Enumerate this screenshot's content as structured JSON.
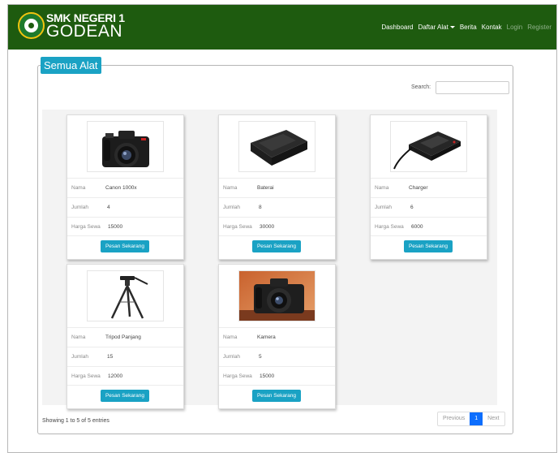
{
  "nav": {
    "brand_line1": "SMK NEGERI 1",
    "brand_line2": "GODEAN",
    "items": [
      {
        "label": "Dashboard"
      },
      {
        "label": "Daftar Alat"
      },
      {
        "label": "Berita"
      },
      {
        "label": "Kontak"
      },
      {
        "label": "Login"
      },
      {
        "label": "Register"
      }
    ]
  },
  "panel": {
    "title": "Semua Alat",
    "search_label": "Search:",
    "search_value": ""
  },
  "labels": {
    "nama": "Nama",
    "jumlah": "Jumlah",
    "harga": "Harga Sewa",
    "button": "Pesan Sekarang"
  },
  "items": [
    {
      "nama": "Canon 1000x",
      "jumlah": "4",
      "harga": "15000",
      "image": "camera-icon"
    },
    {
      "nama": "Baterai",
      "jumlah": "8",
      "harga": "30000",
      "image": "battery-icon"
    },
    {
      "nama": "Charger",
      "jumlah": "6",
      "harga": "6000",
      "image": "charger-icon"
    },
    {
      "nama": "Tripod Panjang",
      "jumlah": "15",
      "harga": "12000",
      "image": "tripod-icon"
    },
    {
      "nama": "Kamera",
      "jumlah": "5",
      "harga": "15000",
      "image": "camera-photo-icon"
    }
  ],
  "footer": {
    "info": "Showing 1 to 5 of 5 entries",
    "previous": "Previous",
    "page": "1",
    "next": "Next"
  },
  "colors": {
    "navbar": "#1e5b0f",
    "accent": "#1aa2c4",
    "page_active": "#0d6efd"
  }
}
